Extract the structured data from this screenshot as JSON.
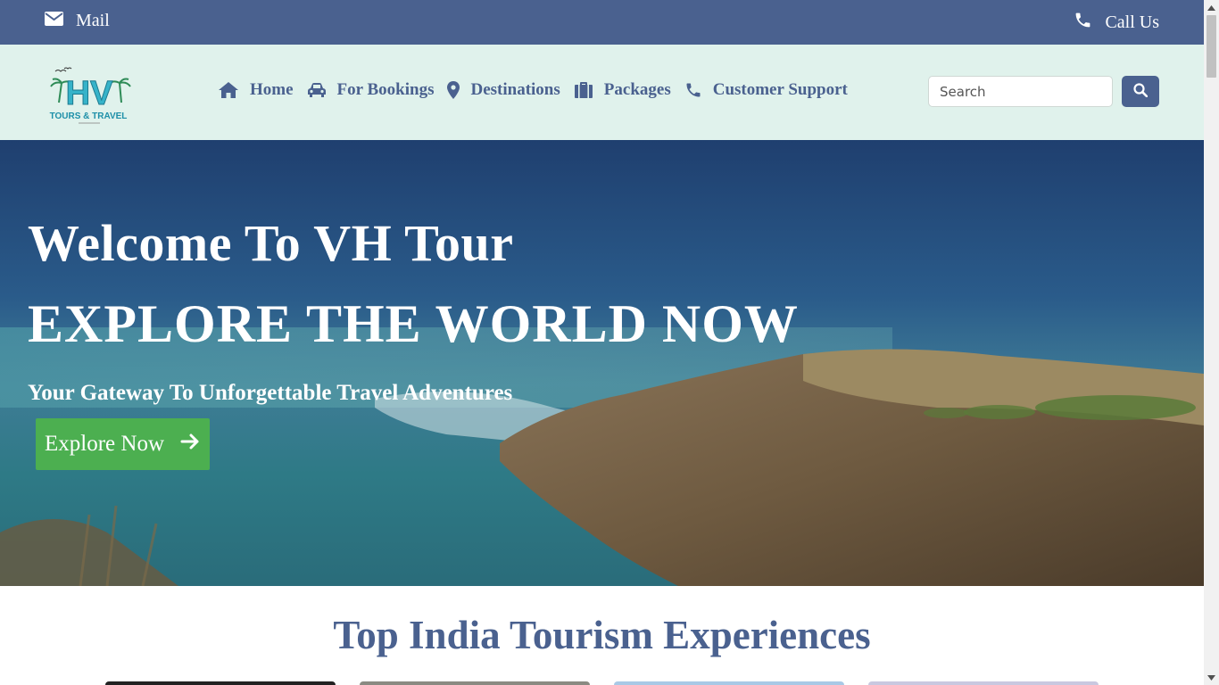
{
  "topbar": {
    "mail_label": "Mail",
    "call_label": "Call Us"
  },
  "logo": {
    "text_main": "HV",
    "text_sub": "TOURS & TRAVEL"
  },
  "nav": {
    "items": [
      {
        "label": "Home",
        "icon": "home-icon"
      },
      {
        "label": "For Bookings",
        "icon": "car-icon"
      },
      {
        "label": "Destinations",
        "icon": "map-marker-icon"
      },
      {
        "label": "Packages",
        "icon": "suitcase-icon"
      },
      {
        "label": "Customer Support",
        "icon": "phone-icon"
      }
    ],
    "search_placeholder": "Search"
  },
  "hero": {
    "welcome": "Welcome To VH Tour",
    "headline": "EXPLORE THE WORLD NOW",
    "tagline": "Your Gateway To Unforgettable Travel Adventures",
    "cta_label": "Explore Now"
  },
  "section": {
    "title": "Top India Tourism Experiences"
  },
  "colors": {
    "primary": "#4a618f",
    "nav_bg": "#e0f2ec",
    "cta": "#4caf50"
  }
}
